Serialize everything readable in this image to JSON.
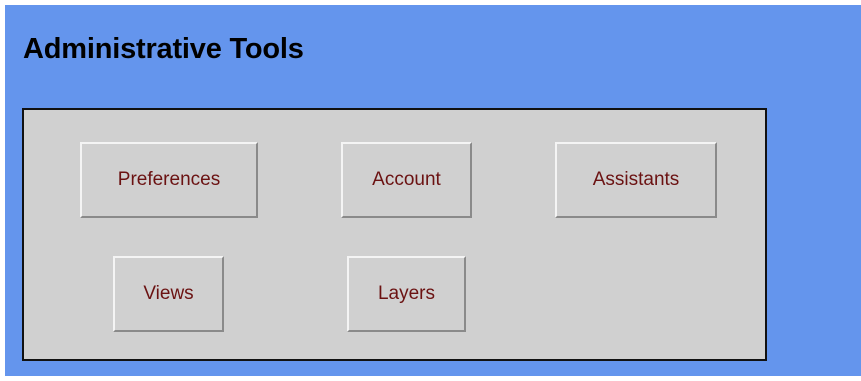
{
  "header": {
    "title": "Administrative Tools"
  },
  "panel": {
    "buttons": [
      {
        "label": "Preferences"
      },
      {
        "label": "Account"
      },
      {
        "label": "Assistants"
      },
      {
        "label": "Views"
      },
      {
        "label": "Layers"
      }
    ]
  },
  "colors": {
    "background": "#6495ed",
    "panel": "#d0d0d0",
    "button_text": "#6b1212"
  }
}
